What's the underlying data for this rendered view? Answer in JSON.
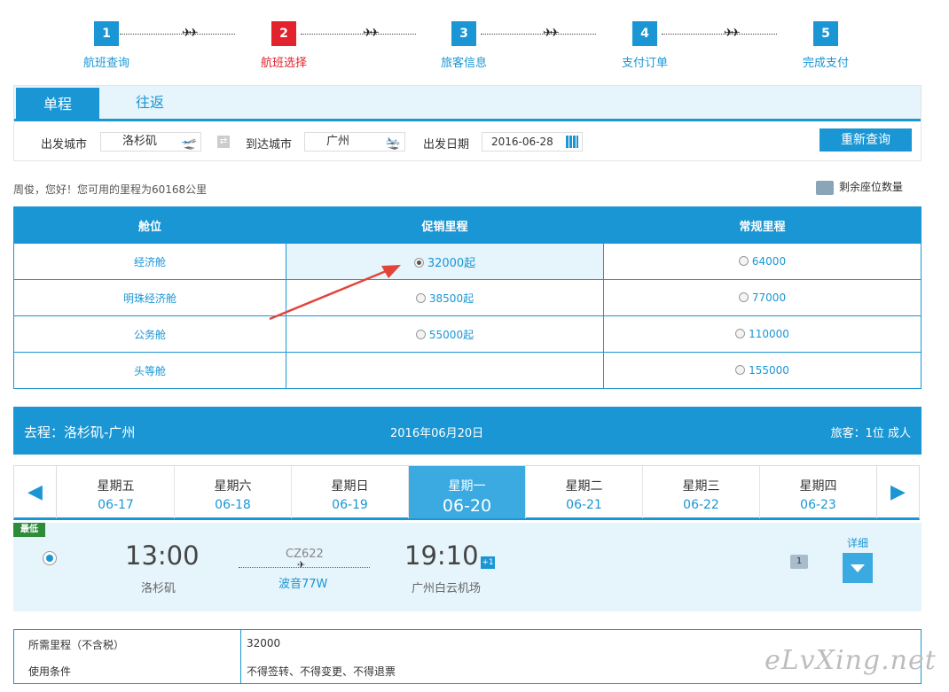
{
  "steps": [
    {
      "num": "1",
      "label": "航班查询"
    },
    {
      "num": "2",
      "label": "航班选择"
    },
    {
      "num": "3",
      "label": "旅客信息"
    },
    {
      "num": "4",
      "label": "支付订单"
    },
    {
      "num": "5",
      "label": "完成支付"
    }
  ],
  "search": {
    "tab_oneway": "单程",
    "tab_round": "往返",
    "from_label": "出发城市",
    "from_value": "洛杉矶",
    "to_label": "到达城市",
    "to_value": "广州",
    "date_label": "出发日期",
    "date_value": "2016-06-28",
    "search_button": "重新查询"
  },
  "greeting": "周俊，您好！您可用的里程为60168公里",
  "seats_label": "剩余座位数量",
  "cabin_table": {
    "headers": [
      "舱位",
      "促销里程",
      "常规里程"
    ],
    "rows": [
      {
        "cabin": "经济舱",
        "promo": "32000起",
        "regular": "64000"
      },
      {
        "cabin": "明珠经济舱",
        "promo": "38500起",
        "regular": "77000"
      },
      {
        "cabin": "公务舱",
        "promo": "55000起",
        "regular": "110000"
      },
      {
        "cabin": "头等舱",
        "promo": "",
        "regular": "155000"
      }
    ]
  },
  "trip": {
    "route": "去程：洛杉矶-广州",
    "date": "2016年06月20日",
    "passengers": "旅客：1位 成人"
  },
  "dates": [
    {
      "weekday": "星期五",
      "date": "06-17"
    },
    {
      "weekday": "星期六",
      "date": "06-18"
    },
    {
      "weekday": "星期日",
      "date": "06-19"
    },
    {
      "weekday": "星期一",
      "date": "06-20"
    },
    {
      "weekday": "星期二",
      "date": "06-21"
    },
    {
      "weekday": "星期三",
      "date": "06-22"
    },
    {
      "weekday": "星期四",
      "date": "06-23"
    }
  ],
  "flight": {
    "badge": "最低",
    "dep_time": "13:00",
    "dep_place": "洛杉矶",
    "flight_no": "CZ622",
    "aircraft": "波音77W",
    "arr_time": "19:10",
    "arr_place": "广州白云机场",
    "day_offset": "+1",
    "seats": "1",
    "detail": "详细"
  },
  "summary": {
    "miles_label": "所需里程（不含税）",
    "miles_value": "32000",
    "cond_label": "使用条件",
    "cond_value": "不得签转、不得变更、不得退票"
  },
  "watermark": "eLvXing.net",
  "colors": {
    "primary": "#1a96d4",
    "active_step": "#e2222d",
    "badge": "#2e8b3a"
  }
}
